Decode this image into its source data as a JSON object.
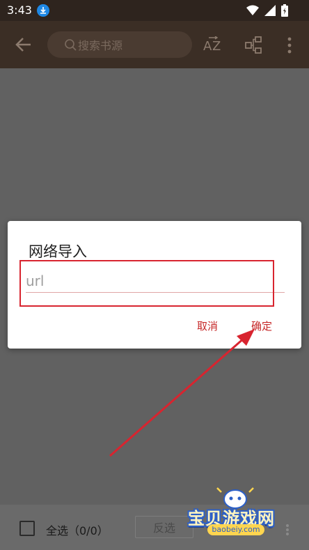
{
  "status_bar": {
    "time": "3:43"
  },
  "toolbar": {
    "search_placeholder": "搜索书源"
  },
  "dialog": {
    "title": "网络导入",
    "url_placeholder": "url",
    "cancel_label": "取消",
    "confirm_label": "确定"
  },
  "bottom_bar": {
    "select_all_label": "全选（0/0）",
    "invert_label": "反选"
  },
  "watermark": {
    "text": "宝贝游戏网",
    "url": "baobeiy.com"
  },
  "colors": {
    "accent_red": "#c62828",
    "toolbar_bg": "#3b2e25",
    "annotation_red": "#d8242f"
  },
  "icons": [
    "download-icon",
    "wifi-icon",
    "signal-icon",
    "battery-icon",
    "back-arrow-icon",
    "search-icon",
    "sort-az-icon",
    "group-icon",
    "more-vert-icon"
  ]
}
